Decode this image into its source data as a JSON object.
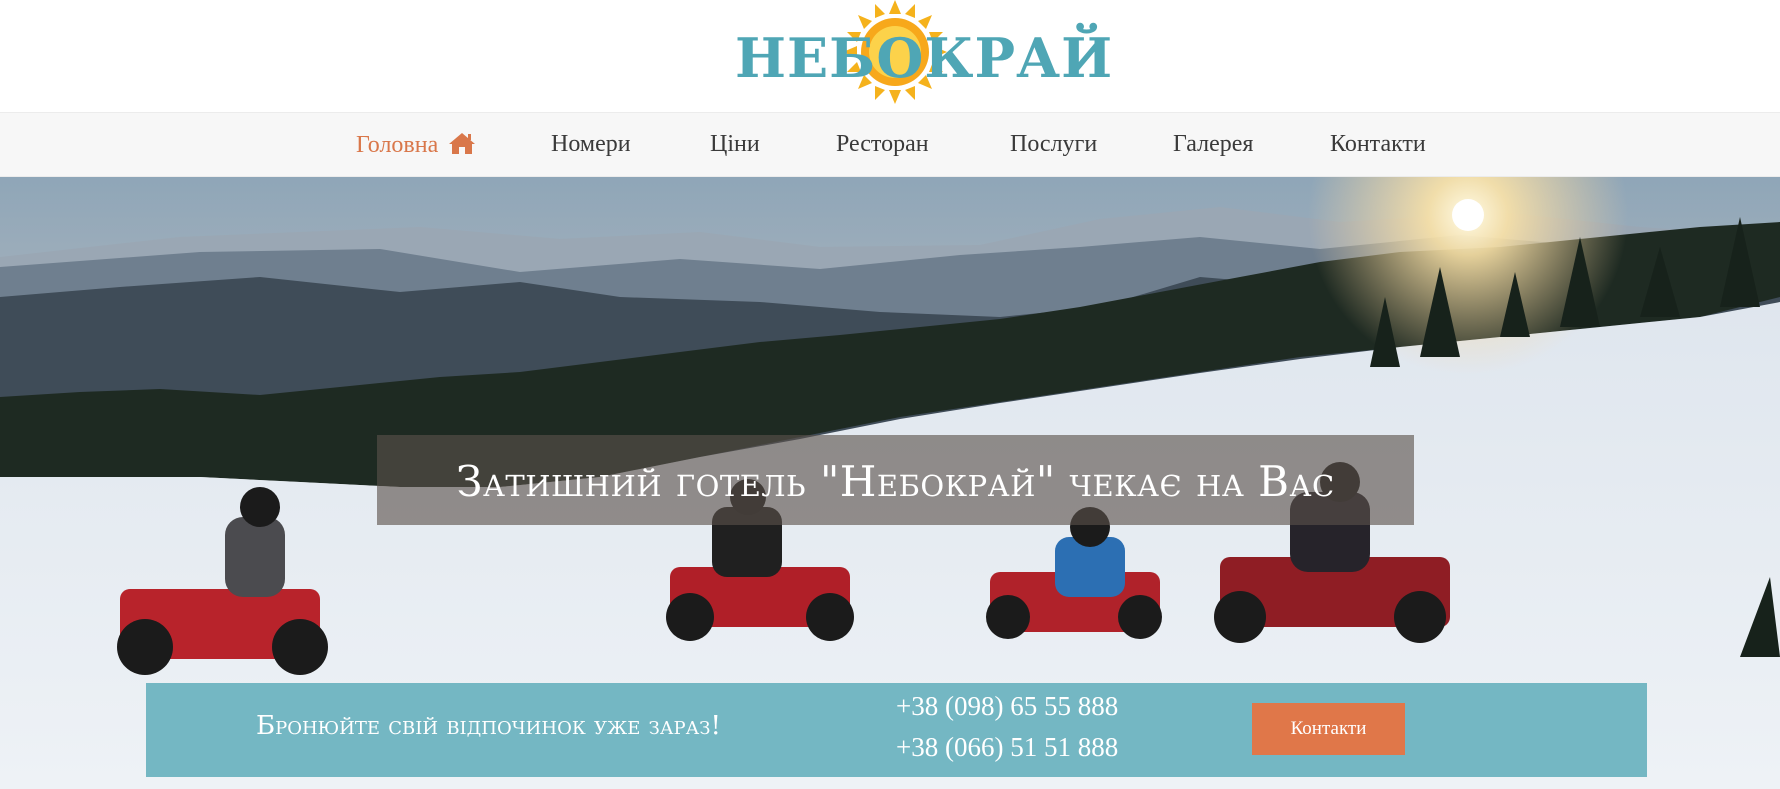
{
  "logo": {
    "text": "НЕБОКРАЙ"
  },
  "nav": {
    "items": [
      {
        "label": "Головна",
        "active": true
      },
      {
        "label": "Номери"
      },
      {
        "label": "Ціни"
      },
      {
        "label": "Ресторан"
      },
      {
        "label": "Послуги"
      },
      {
        "label": "Галерея"
      },
      {
        "label": "Контакти"
      }
    ]
  },
  "hero": {
    "title": "Затишний готель \"Небокрай\" чекає на Вас"
  },
  "booking": {
    "text": "Бронюйте свій відпочинок уже зараз!",
    "phone1": "+38 (098) 65 55 888",
    "phone2": "+38 (066) 51 51 888",
    "button_label": "Контакти"
  },
  "colors": {
    "accent": "#e07749",
    "teal": "#74b7c3",
    "logo_teal": "#4fa6b5",
    "sun": "#f5b21c"
  }
}
